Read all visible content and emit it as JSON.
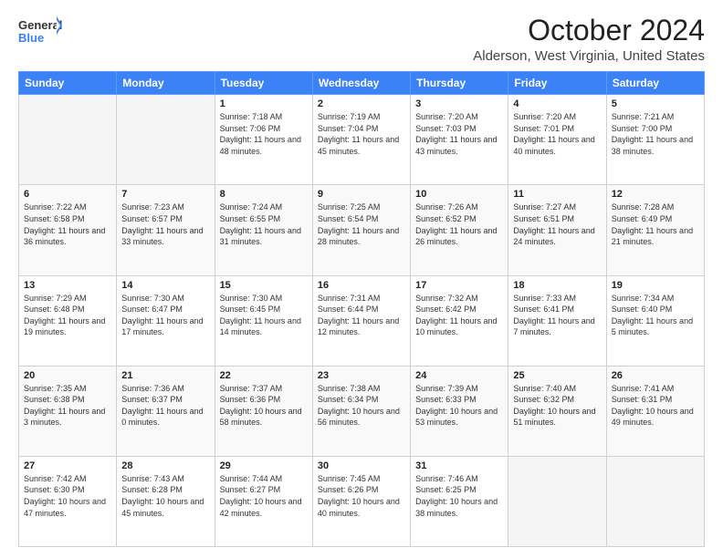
{
  "logo": {
    "line1": "General",
    "line2": "Blue"
  },
  "title": "October 2024",
  "location": "Alderson, West Virginia, United States",
  "days_header": [
    "Sunday",
    "Monday",
    "Tuesday",
    "Wednesday",
    "Thursday",
    "Friday",
    "Saturday"
  ],
  "weeks": [
    [
      {
        "day": "",
        "empty": true
      },
      {
        "day": "",
        "empty": true
      },
      {
        "day": "1",
        "sunrise": "7:18 AM",
        "sunset": "7:06 PM",
        "daylight": "11 hours and 48 minutes."
      },
      {
        "day": "2",
        "sunrise": "7:19 AM",
        "sunset": "7:04 PM",
        "daylight": "11 hours and 45 minutes."
      },
      {
        "day": "3",
        "sunrise": "7:20 AM",
        "sunset": "7:03 PM",
        "daylight": "11 hours and 43 minutes."
      },
      {
        "day": "4",
        "sunrise": "7:20 AM",
        "sunset": "7:01 PM",
        "daylight": "11 hours and 40 minutes."
      },
      {
        "day": "5",
        "sunrise": "7:21 AM",
        "sunset": "7:00 PM",
        "daylight": "11 hours and 38 minutes."
      }
    ],
    [
      {
        "day": "6",
        "sunrise": "7:22 AM",
        "sunset": "6:58 PM",
        "daylight": "11 hours and 36 minutes."
      },
      {
        "day": "7",
        "sunrise": "7:23 AM",
        "sunset": "6:57 PM",
        "daylight": "11 hours and 33 minutes."
      },
      {
        "day": "8",
        "sunrise": "7:24 AM",
        "sunset": "6:55 PM",
        "daylight": "11 hours and 31 minutes."
      },
      {
        "day": "9",
        "sunrise": "7:25 AM",
        "sunset": "6:54 PM",
        "daylight": "11 hours and 28 minutes."
      },
      {
        "day": "10",
        "sunrise": "7:26 AM",
        "sunset": "6:52 PM",
        "daylight": "11 hours and 26 minutes."
      },
      {
        "day": "11",
        "sunrise": "7:27 AM",
        "sunset": "6:51 PM",
        "daylight": "11 hours and 24 minutes."
      },
      {
        "day": "12",
        "sunrise": "7:28 AM",
        "sunset": "6:49 PM",
        "daylight": "11 hours and 21 minutes."
      }
    ],
    [
      {
        "day": "13",
        "sunrise": "7:29 AM",
        "sunset": "6:48 PM",
        "daylight": "11 hours and 19 minutes."
      },
      {
        "day": "14",
        "sunrise": "7:30 AM",
        "sunset": "6:47 PM",
        "daylight": "11 hours and 17 minutes."
      },
      {
        "day": "15",
        "sunrise": "7:30 AM",
        "sunset": "6:45 PM",
        "daylight": "11 hours and 14 minutes."
      },
      {
        "day": "16",
        "sunrise": "7:31 AM",
        "sunset": "6:44 PM",
        "daylight": "11 hours and 12 minutes."
      },
      {
        "day": "17",
        "sunrise": "7:32 AM",
        "sunset": "6:42 PM",
        "daylight": "11 hours and 10 minutes."
      },
      {
        "day": "18",
        "sunrise": "7:33 AM",
        "sunset": "6:41 PM",
        "daylight": "11 hours and 7 minutes."
      },
      {
        "day": "19",
        "sunrise": "7:34 AM",
        "sunset": "6:40 PM",
        "daylight": "11 hours and 5 minutes."
      }
    ],
    [
      {
        "day": "20",
        "sunrise": "7:35 AM",
        "sunset": "6:38 PM",
        "daylight": "11 hours and 3 minutes."
      },
      {
        "day": "21",
        "sunrise": "7:36 AM",
        "sunset": "6:37 PM",
        "daylight": "11 hours and 0 minutes."
      },
      {
        "day": "22",
        "sunrise": "7:37 AM",
        "sunset": "6:36 PM",
        "daylight": "10 hours and 58 minutes."
      },
      {
        "day": "23",
        "sunrise": "7:38 AM",
        "sunset": "6:34 PM",
        "daylight": "10 hours and 56 minutes."
      },
      {
        "day": "24",
        "sunrise": "7:39 AM",
        "sunset": "6:33 PM",
        "daylight": "10 hours and 53 minutes."
      },
      {
        "day": "25",
        "sunrise": "7:40 AM",
        "sunset": "6:32 PM",
        "daylight": "10 hours and 51 minutes."
      },
      {
        "day": "26",
        "sunrise": "7:41 AM",
        "sunset": "6:31 PM",
        "daylight": "10 hours and 49 minutes."
      }
    ],
    [
      {
        "day": "27",
        "sunrise": "7:42 AM",
        "sunset": "6:30 PM",
        "daylight": "10 hours and 47 minutes."
      },
      {
        "day": "28",
        "sunrise": "7:43 AM",
        "sunset": "6:28 PM",
        "daylight": "10 hours and 45 minutes."
      },
      {
        "day": "29",
        "sunrise": "7:44 AM",
        "sunset": "6:27 PM",
        "daylight": "10 hours and 42 minutes."
      },
      {
        "day": "30",
        "sunrise": "7:45 AM",
        "sunset": "6:26 PM",
        "daylight": "10 hours and 40 minutes."
      },
      {
        "day": "31",
        "sunrise": "7:46 AM",
        "sunset": "6:25 PM",
        "daylight": "10 hours and 38 minutes."
      },
      {
        "day": "",
        "empty": true
      },
      {
        "day": "",
        "empty": true
      }
    ]
  ]
}
